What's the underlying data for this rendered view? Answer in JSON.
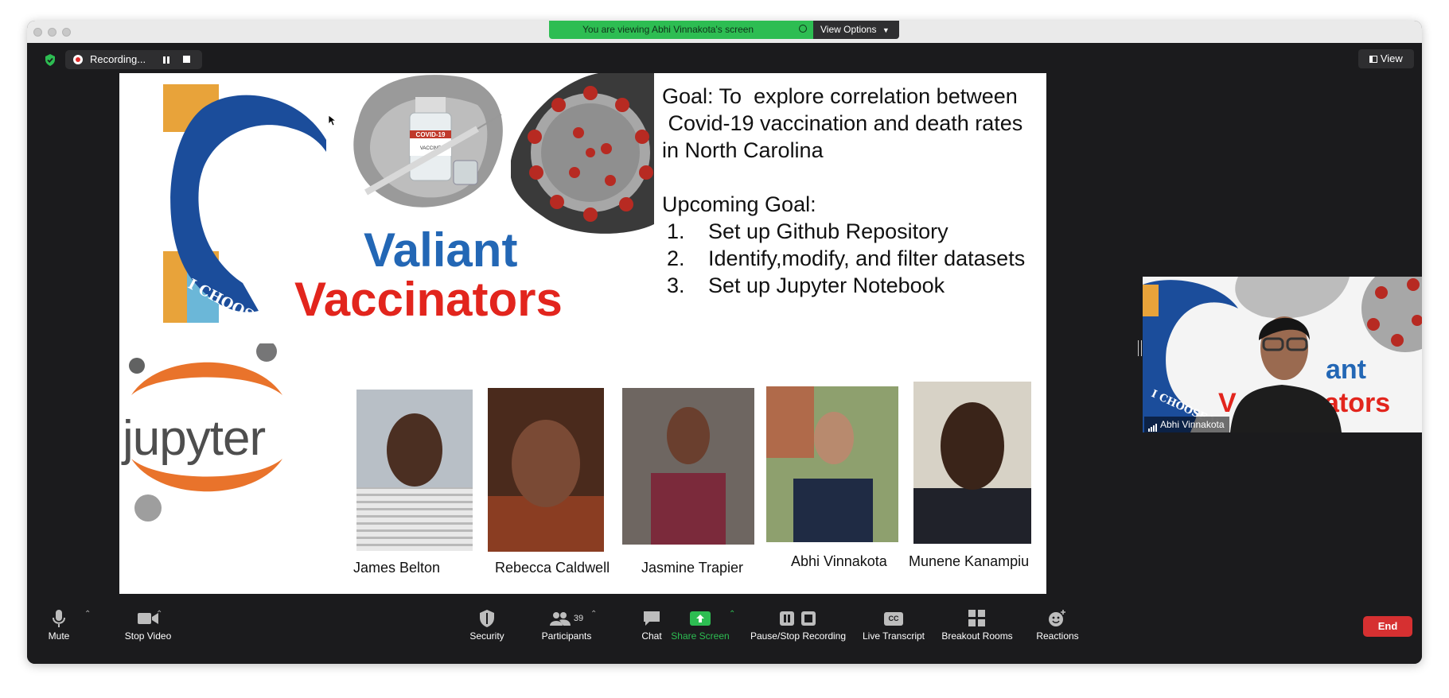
{
  "banner": {
    "viewing_text": "You are viewing Abhi Vinnakota's screen",
    "view_options": "View Options"
  },
  "recording": {
    "label": "Recording..."
  },
  "stage": {
    "view_label": "View"
  },
  "slide": {
    "goal_lines": [
      "Goal: To  explore correlation between",
      " Covid-19 vaccination and death rates",
      "in North Carolina"
    ],
    "upcoming_title": "Upcoming Goal:",
    "upcoming_items": [
      {
        "num": "1.",
        "text": "Set up Github Repository"
      },
      {
        "num": "2.",
        "text": "Identify,modify, and filter datasets"
      },
      {
        "num": "3.",
        "text": "Set up Jupyter Notebook"
      }
    ],
    "team_title_line1": "Valiant",
    "team_title_line2": "Vaccinators",
    "badge_text": "I CHOOSE V",
    "vaccine_label": "COVID-19",
    "vaccine_sublabel": "VACCINE",
    "jupyter_text": "jupyter",
    "members": [
      "James Belton",
      "Rebecca Caldwell",
      "Jasmine Trapier",
      "Abhi Vinnakota",
      "Munene Kanampiu"
    ]
  },
  "pip": {
    "name": "Abhi Vinnakota",
    "title_fragment1": "ant",
    "title_fragment2": "V",
    "title_fragment3": "ators",
    "badge_fragment": "I CHOOSE V"
  },
  "toolbar": {
    "mute": "Mute",
    "stop_video": "Stop Video",
    "security": "Security",
    "participants": "Participants",
    "participants_count": "39",
    "chat": "Chat",
    "share_screen": "Share Screen",
    "pause_stop_recording": "Pause/Stop Recording",
    "live_transcript": "Live Transcript",
    "breakout_rooms": "Breakout Rooms",
    "reactions": "Reactions",
    "end": "End",
    "cc": "CC"
  },
  "colors": {
    "accent_green": "#2dbd52",
    "end_red": "#d63031",
    "title_blue": "#2367b5",
    "title_red": "#e2251d",
    "jupyter_orange": "#e9732b"
  }
}
